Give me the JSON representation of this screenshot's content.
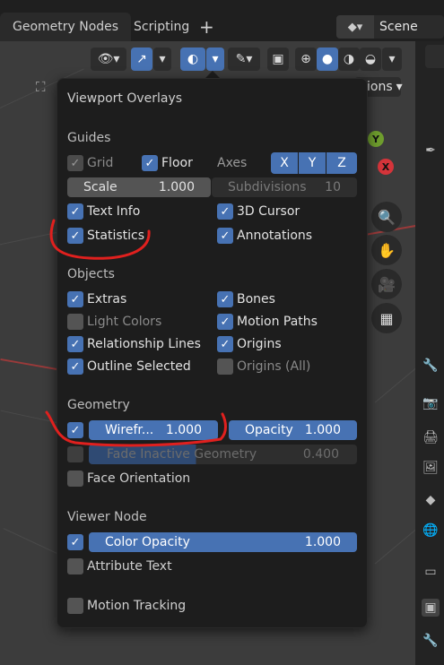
{
  "workspace_tabs": [
    {
      "label": "Geometry Nodes"
    },
    {
      "label": "Scripting"
    }
  ],
  "scene": {
    "label": "Scene"
  },
  "header_partial_text": "ions",
  "gizmo_axes": {
    "y": "Y",
    "x": "X"
  },
  "overlays": {
    "title": "Viewport Overlays",
    "guides": {
      "heading": "Guides",
      "grid": "Grid",
      "floor": "Floor",
      "axes_label": "Axes",
      "axes": [
        "X",
        "Y",
        "Z"
      ],
      "scale_label": "Scale",
      "scale_value": "1.000",
      "subdivisions_label": "Subdivisions",
      "subdivisions_value": "10",
      "text_info": "Text Info",
      "cursor_3d": "3D Cursor",
      "statistics": "Statistics",
      "annotations": "Annotations"
    },
    "objects": {
      "heading": "Objects",
      "extras": "Extras",
      "bones": "Bones",
      "light_colors": "Light Colors",
      "motion_paths": "Motion Paths",
      "relationship_lines": "Relationship Lines",
      "origins": "Origins",
      "outline_selected": "Outline Selected",
      "origins_all": "Origins (All)"
    },
    "geometry": {
      "heading": "Geometry",
      "wireframe_label": "Wirefr...",
      "wireframe_value": "1.000",
      "opacity_label": "Opacity",
      "opacity_value": "1.000",
      "fade_label": "Fade Inactive Geometry",
      "fade_value": "0.400",
      "face_orientation": "Face Orientation"
    },
    "viewer_node": {
      "heading": "Viewer Node",
      "color_opacity_label": "Color Opacity",
      "color_opacity_value": "1.000",
      "attribute_text": "Attribute Text"
    },
    "motion_tracking": "Motion Tracking",
    "checkbox_states": {
      "grid": true,
      "floor": true,
      "text_info": true,
      "cursor_3d": true,
      "statistics": true,
      "annotations": true,
      "extras": true,
      "bones": true,
      "light_colors": false,
      "motion_paths": true,
      "relationship_lines": true,
      "origins": true,
      "outline_selected": true,
      "origins_all": false,
      "wireframe": true,
      "fade_inactive": false,
      "face_orientation": false,
      "color_opacity": true,
      "attribute_text": false,
      "motion_tracking": false
    }
  },
  "colors": {
    "accent": "#4772b3",
    "panel_bg": "#1d1d1d",
    "annotation": "#e0201e"
  }
}
